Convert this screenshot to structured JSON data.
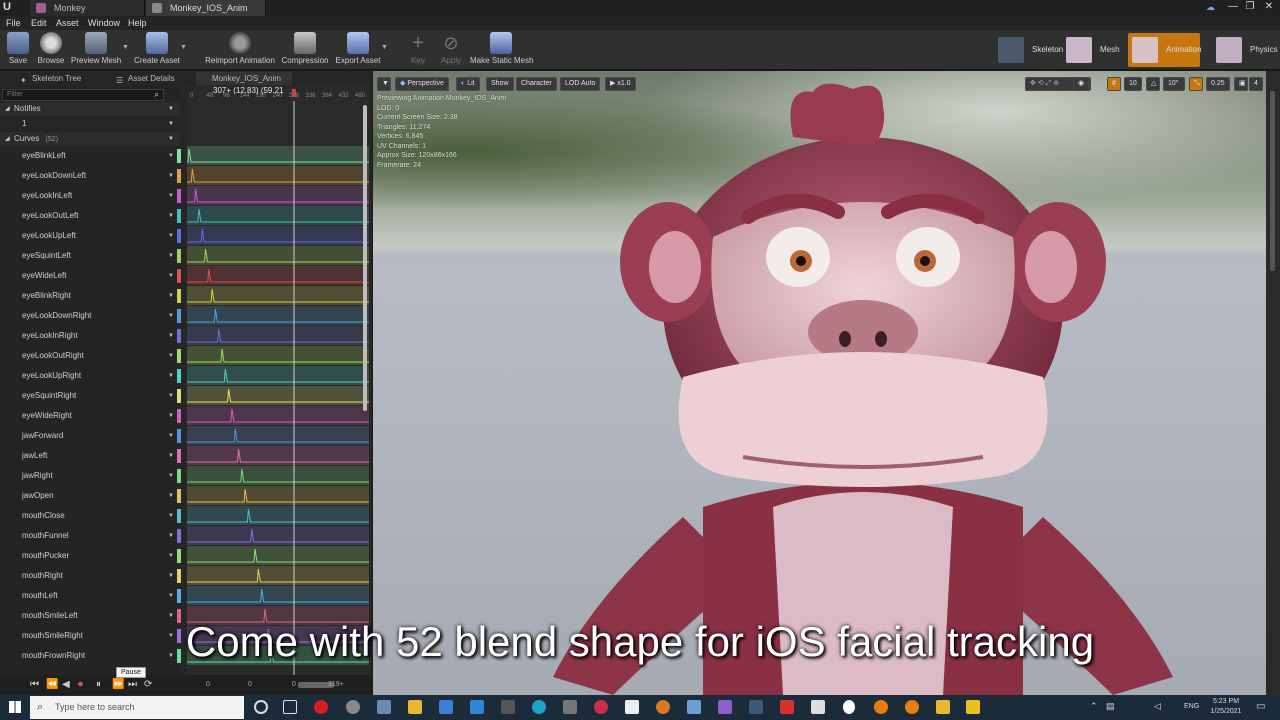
{
  "window": {
    "tabs": [
      "Monkey",
      "Monkey_IOS_Anim"
    ],
    "controls": [
      "—",
      "❐",
      "✕"
    ]
  },
  "menu": [
    "File",
    "Edit",
    "Asset",
    "Window",
    "Help"
  ],
  "toolbar": {
    "buttons": [
      {
        "label": "Save",
        "icon": "save-icon"
      },
      {
        "label": "Browse",
        "icon": "browse-icon"
      },
      {
        "label": "Preview Mesh",
        "icon": "preview-mesh-icon"
      },
      {
        "label": "Create Asset",
        "icon": "create-asset-icon"
      },
      {
        "label": "Reimport Animation",
        "icon": "reimport-icon"
      },
      {
        "label": "Compression",
        "icon": "compression-icon"
      },
      {
        "label": "Export Asset",
        "icon": "export-icon"
      },
      {
        "label": "Key",
        "icon": "key-icon"
      },
      {
        "label": "Apply",
        "icon": "apply-icon"
      },
      {
        "label": "Make Static Mesh",
        "icon": "static-mesh-icon"
      }
    ],
    "modes": [
      "Skeleton",
      "Mesh",
      "Animation",
      "Physics"
    ]
  },
  "panel_tabs": [
    "Skeleton Tree",
    "Asset Details",
    "Monkey_IOS_Anim"
  ],
  "curves_panel": {
    "filter_placeholder": "Filter",
    "notifies_label": "Notifies",
    "notifies_track": "1",
    "curves_label": "Curves",
    "curves_count": "(52)",
    "time_readout": "307+ (12.83) (59.21",
    "ruler_ticks": [
      "0",
      "48",
      "96",
      "144",
      "192",
      "240",
      "288",
      "336",
      "384",
      "432",
      "480"
    ],
    "curves": [
      {
        "name": "eyeBlinkLeft",
        "color": "#7fe3a0"
      },
      {
        "name": "eyeLookDownLeft",
        "color": "#e0a040"
      },
      {
        "name": "eyeLookInLeft",
        "color": "#c060d0"
      },
      {
        "name": "eyeLookOutLeft",
        "color": "#40c0c0"
      },
      {
        "name": "eyeLookUpLeft",
        "color": "#6070e0"
      },
      {
        "name": "eyeSquintLeft",
        "color": "#a0d060"
      },
      {
        "name": "eyeWideLeft",
        "color": "#e05050"
      },
      {
        "name": "eyeBlinkRight",
        "color": "#d0d050"
      },
      {
        "name": "eyeLookDownRight",
        "color": "#50a0e0"
      },
      {
        "name": "eyeLookInRight",
        "color": "#7070d0"
      },
      {
        "name": "eyeLookOutRight",
        "color": "#a0e060"
      },
      {
        "name": "eyeLookUpRight",
        "color": "#50d0c0"
      },
      {
        "name": "eyeSquintRight",
        "color": "#e0e070"
      },
      {
        "name": "eyeWideRight",
        "color": "#d060c0"
      },
      {
        "name": "jawForward",
        "color": "#6090e0"
      },
      {
        "name": "jawLeft",
        "color": "#e070b0"
      },
      {
        "name": "jawRight",
        "color": "#70e080"
      },
      {
        "name": "jawOpen",
        "color": "#e0c050"
      },
      {
        "name": "mouthClose",
        "color": "#50c0d0"
      },
      {
        "name": "mouthFunnel",
        "color": "#8070e0"
      },
      {
        "name": "mouthPucker",
        "color": "#90e070"
      },
      {
        "name": "mouthRight",
        "color": "#e0d060"
      },
      {
        "name": "mouthLeft",
        "color": "#50b0e0"
      },
      {
        "name": "mouthSmileLeft",
        "color": "#e06090"
      },
      {
        "name": "mouthSmileRight",
        "color": "#a070e0"
      },
      {
        "name": "mouthFrownRight",
        "color": "#60e0a0"
      }
    ]
  },
  "transport": {
    "tooltip": "Pause",
    "start": "0",
    "mid": "0",
    "end": "0",
    "end_label": "319+"
  },
  "viewport": {
    "buttons": [
      "Perspective",
      "Lit",
      "Show",
      "Character",
      "LOD Auto",
      "x1.0"
    ],
    "grid_value": "10",
    "angle_value": "10°",
    "scale_value": "0.25",
    "cam_value": "4",
    "stats": [
      "Previewing Animation Monkey_IOS_Anim",
      "LOD: 0",
      "Current Screen Size: 2.38",
      "Triangles: 11,274",
      "Vertices: 6,845",
      "UV Channels: 1",
      "Approx Size: 120x86x166",
      "Framerate: 24"
    ]
  },
  "caption": "Come with 52 blend shape for iOS facial tracking",
  "taskbar": {
    "search_placeholder": "Type here to search",
    "lang": "ENG",
    "time": "5:23 PM",
    "date": "1/25/2021"
  }
}
